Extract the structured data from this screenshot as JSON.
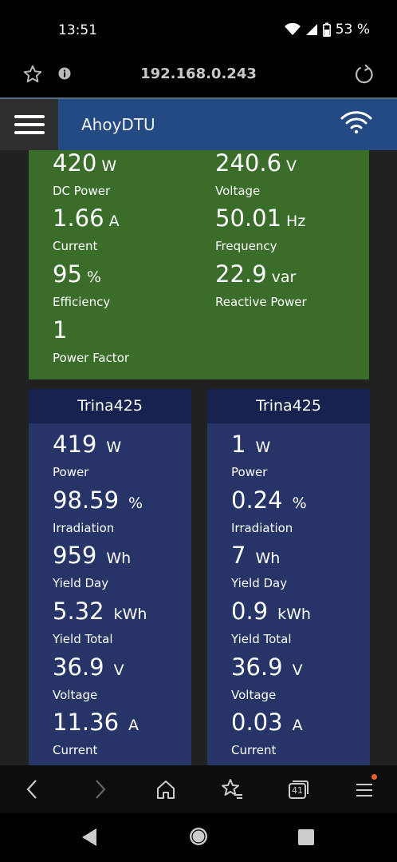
{
  "status_bar": {
    "time": "13:51",
    "battery_percent": "53 %",
    "icons": [
      "wifi-icon",
      "signal-icon",
      "battery-icon"
    ]
  },
  "browser": {
    "url": "192.168.0.243",
    "icons": [
      "star-icon",
      "info-icon",
      "reload-icon"
    ]
  },
  "app": {
    "title": "AhoyDTU",
    "icons": [
      "hamburger-menu-icon",
      "wifi-icon"
    ]
  },
  "inverter_total": {
    "metrics": [
      {
        "value": "420",
        "unit": "W",
        "label": "DC Power"
      },
      {
        "value": "240.6",
        "unit": "V",
        "label": "Voltage"
      },
      {
        "value": "1.66",
        "unit": "A",
        "label": "Current"
      },
      {
        "value": "50.01",
        "unit": "Hz",
        "label": "Frequency"
      },
      {
        "value": "95",
        "unit": "%",
        "label": "Efficiency"
      },
      {
        "value": "22.9",
        "unit": "var",
        "label": "Reactive Power"
      },
      {
        "value": "1",
        "unit": "",
        "label": "Power Factor"
      }
    ]
  },
  "panels": [
    {
      "name": "Trina425",
      "metrics": [
        {
          "value": "419",
          "unit": "W",
          "label": "Power"
        },
        {
          "value": "98.59",
          "unit": "%",
          "label": "Irradiation"
        },
        {
          "value": "959",
          "unit": "Wh",
          "label": "Yield Day"
        },
        {
          "value": "5.32",
          "unit": "kWh",
          "label": "Yield Total"
        },
        {
          "value": "36.9",
          "unit": "V",
          "label": "Voltage"
        },
        {
          "value": "11.36",
          "unit": "A",
          "label": "Current"
        }
      ]
    },
    {
      "name": "Trina425",
      "metrics": [
        {
          "value": "1",
          "unit": "W",
          "label": "Power"
        },
        {
          "value": "0.24",
          "unit": "%",
          "label": "Irradiation"
        },
        {
          "value": "7",
          "unit": "Wh",
          "label": "Yield Day"
        },
        {
          "value": "0.9",
          "unit": "kWh",
          "label": "Yield Total"
        },
        {
          "value": "36.9",
          "unit": "V",
          "label": "Voltage"
        },
        {
          "value": "0.03",
          "unit": "A",
          "label": "Current"
        }
      ]
    }
  ],
  "browser_nav": {
    "tab_count": "41",
    "icons": [
      "back-icon",
      "forward-icon",
      "home-icon",
      "bookmarks-icon",
      "tabs-icon",
      "menu-icon"
    ],
    "notification_dot_color": "#e8622c"
  },
  "system_nav": {
    "icons": [
      "system-back-icon",
      "system-home-icon",
      "system-recents-icon"
    ]
  }
}
